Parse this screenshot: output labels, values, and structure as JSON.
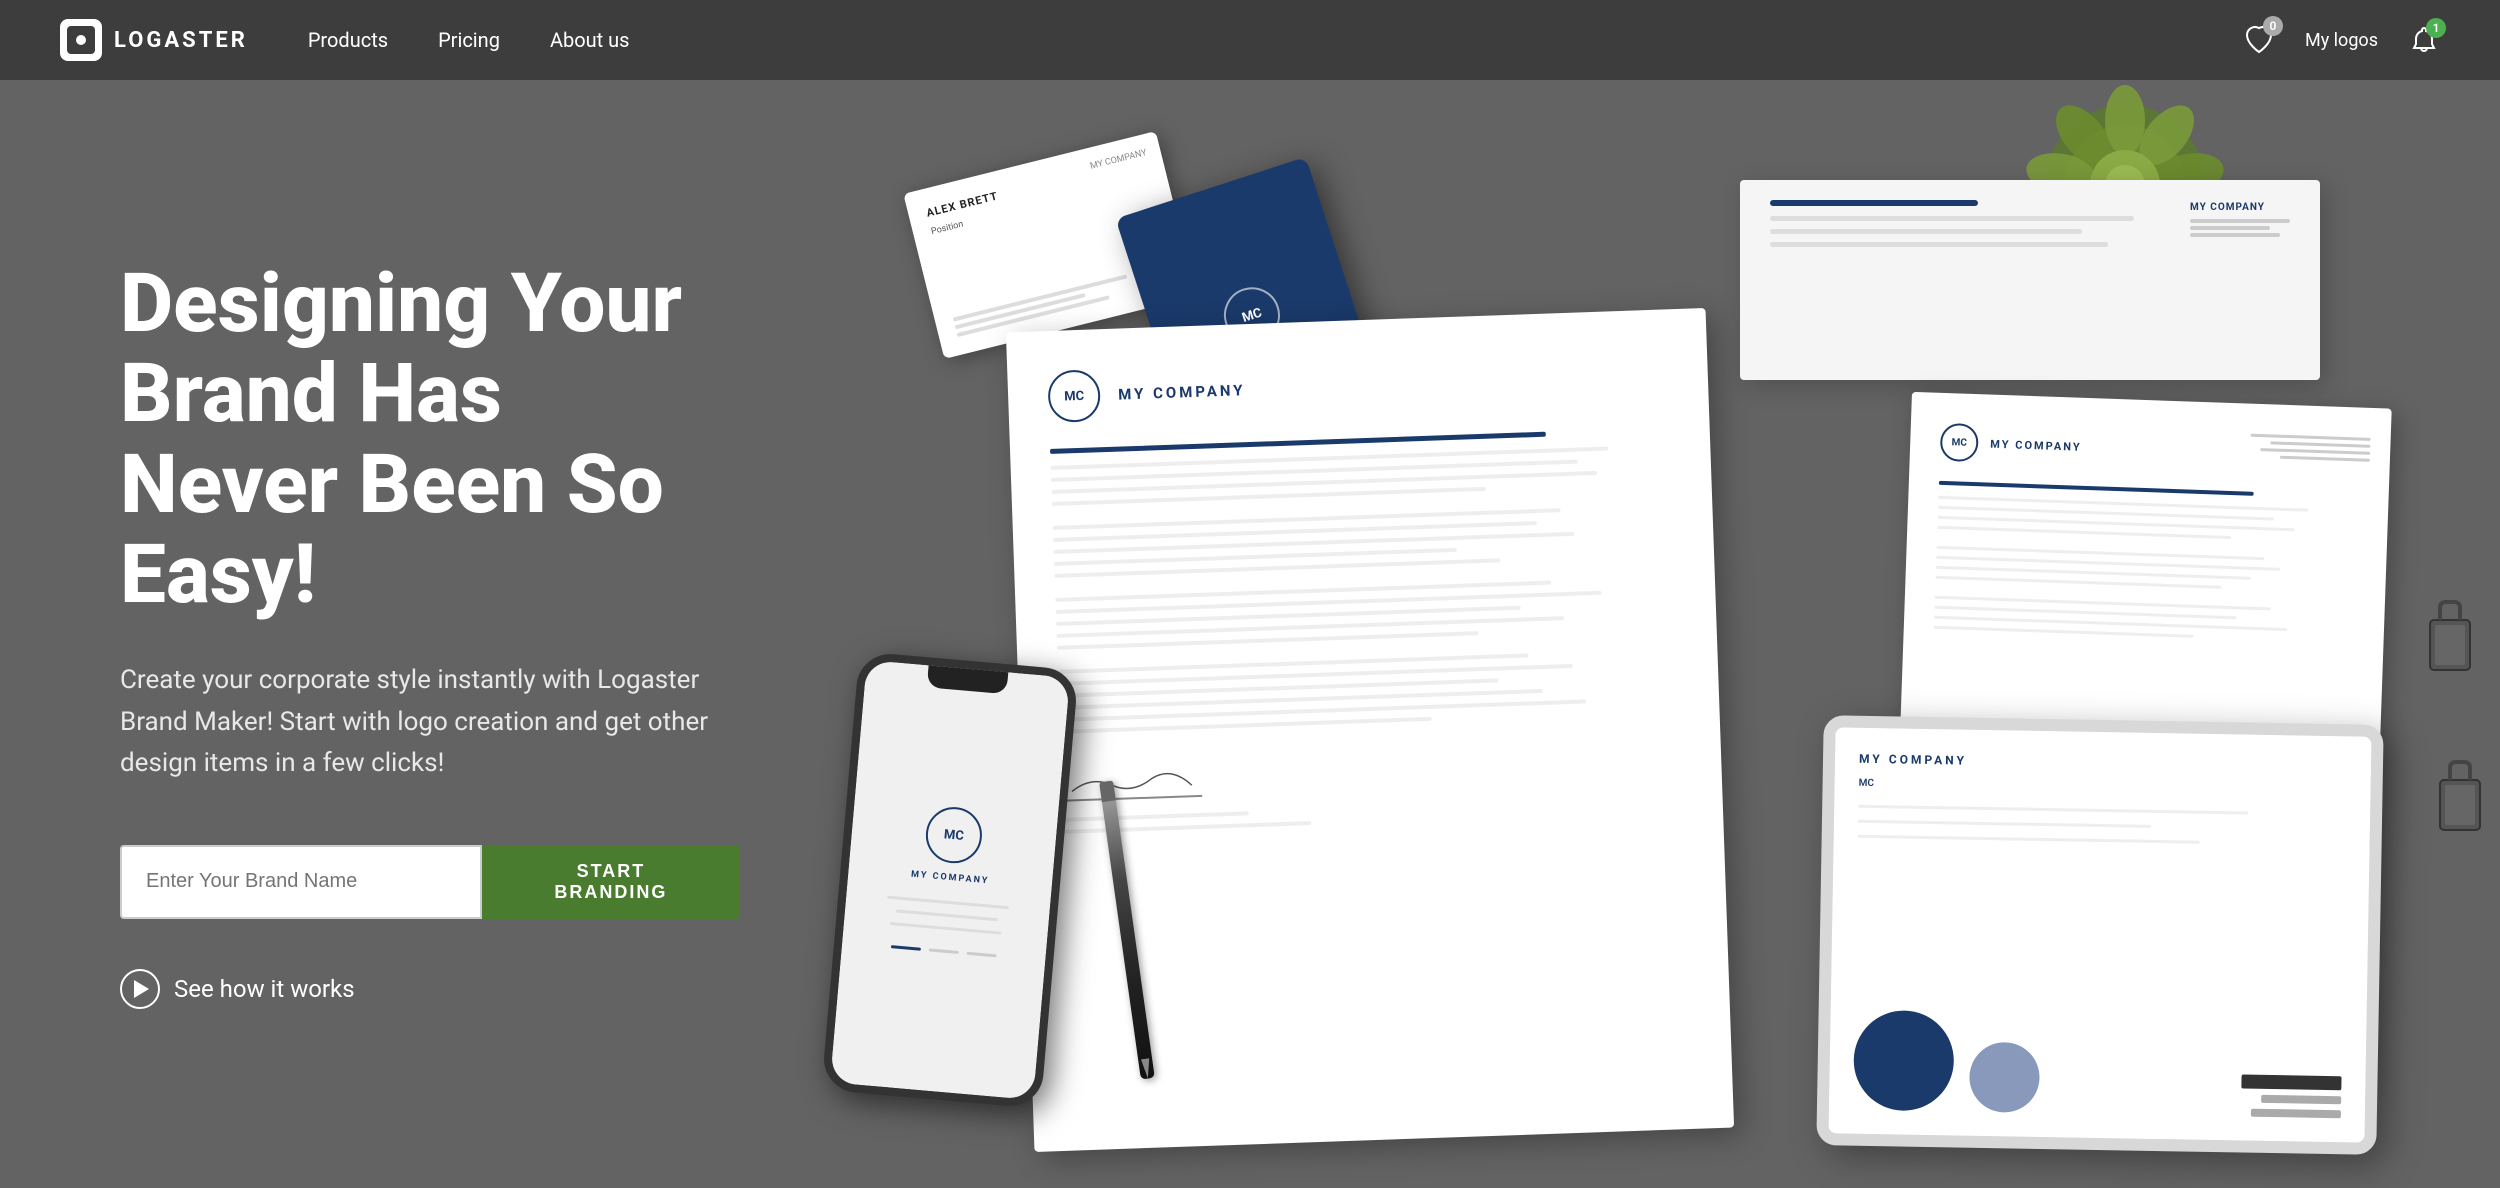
{
  "brand": "LOGASTER",
  "nav": {
    "products_label": "Products",
    "pricing_label": "Pricing",
    "about_label": "About us",
    "my_logos_label": "My logos",
    "heart_count": "0",
    "bell_count": "1"
  },
  "hero": {
    "heading": "Designing Your Brand Has Never Been So Easy!",
    "subtext": "Create your corporate style instantly with Logaster Brand Maker! Start with logo creation and get other design items in a few clicks!",
    "input_placeholder": "Enter Your Brand Name",
    "start_btn": "START BRANDING",
    "see_how": "See how it works"
  },
  "brand_materials": {
    "company_name": "MY COMPANY",
    "mc_initials": "MC"
  }
}
